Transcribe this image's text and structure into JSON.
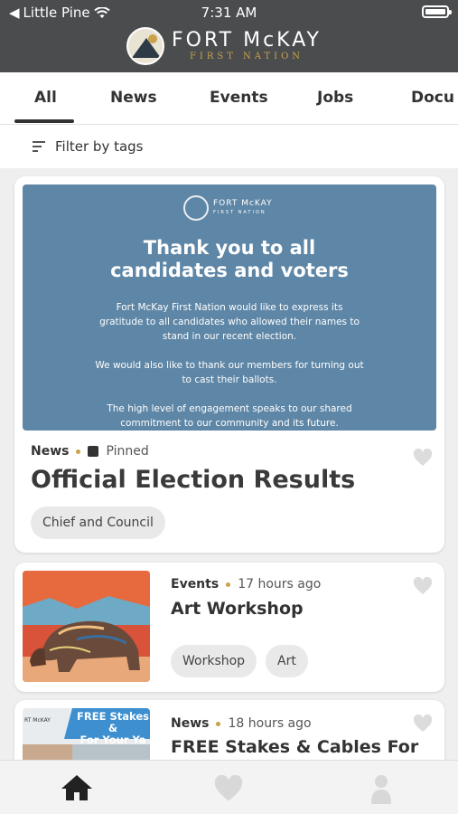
{
  "status": {
    "carrier": "Little Pine",
    "time": "7:31 AM"
  },
  "brand": {
    "name": "FORT McKAY",
    "subtitle": "FIRST NATION"
  },
  "tabs": [
    {
      "label": "All",
      "active": true
    },
    {
      "label": "News"
    },
    {
      "label": "Events"
    },
    {
      "label": "Jobs"
    },
    {
      "label": "Docu"
    }
  ],
  "filter": {
    "label": "Filter by tags"
  },
  "posts": [
    {
      "banner": {
        "logo_name": "FORT McKAY",
        "logo_sub": "FIRST NATION",
        "headline_1": "Thank you to all",
        "headline_2": "candidates and voters",
        "paragraphs": [
          "Fort McKay First Nation would like to express its gratitude to all candidates who allowed their names to stand in our recent election.",
          "We would also like to thank our members for turning out to cast their ballots.",
          "The high level of engagement speaks to our shared commitment to our community and its future."
        ]
      },
      "category": "News",
      "status": "Pinned",
      "title": "Official Election Results",
      "tags": [
        "Chief and Council"
      ]
    },
    {
      "category": "Events",
      "time": "17 hours ago",
      "title": "Art Workshop",
      "tags": [
        "Workshop",
        "Art"
      ]
    },
    {
      "category": "News",
      "time": "18 hours ago",
      "title": "FREE Stakes & Cables For",
      "thumb_header": "RT McKAY",
      "thumb_text_1": "FREE Stakes &",
      "thumb_text_2": "For Your Ya"
    }
  ],
  "colors": {
    "header": "#4a4c4e",
    "accent": "#c9a24a",
    "banner": "#5e86a6"
  },
  "icons": [
    "home-icon",
    "heart-icon",
    "person-icon",
    "wifi-icon",
    "battery-icon",
    "filter-icon",
    "pin-icon"
  ]
}
